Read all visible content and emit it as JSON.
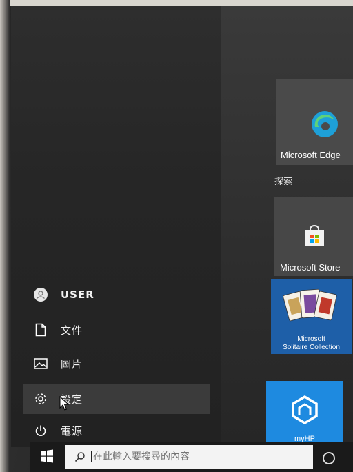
{
  "start_menu": {
    "items": [
      {
        "label": "USER",
        "icon": "user-avatar-icon"
      },
      {
        "label": "文件",
        "icon": "document-icon"
      },
      {
        "label": "圖片",
        "icon": "pictures-icon"
      },
      {
        "label": "設定",
        "icon": "gear-icon"
      },
      {
        "label": "電源",
        "icon": "power-icon"
      }
    ]
  },
  "tiles": {
    "edge": {
      "label": "Microsoft Edge",
      "icon": "edge-icon"
    },
    "group_label": "探索",
    "store": {
      "label": "Microsoft Store",
      "icon": "store-bag-icon"
    },
    "solitaire": {
      "label_line1": "Microsoft",
      "label_line2": "Solitaire Collection",
      "icon": "playing-cards-icon"
    },
    "myhp": {
      "label": "myHP",
      "icon": "hp-house-icon"
    }
  },
  "taskbar": {
    "search_placeholder": "在此輸入要搜尋的內容",
    "start_icon": "windows-logo-icon",
    "cortana_icon": "cortana-circle-icon"
  },
  "colors": {
    "solitaire_tile": "#1e5fa8",
    "myhp_tile": "#1e8ae0",
    "selected_item": "#3b3b3b"
  }
}
